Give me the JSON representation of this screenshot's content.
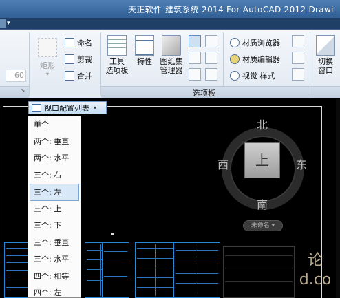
{
  "window": {
    "title": "天正软件-建筑系统 2014  For AutoCAD 2012   Drawi"
  },
  "ribbon": {
    "left_field_value": "60",
    "rect_label": "矩形",
    "rect_caret": "▾",
    "small_buttons": [
      "命名",
      "剪裁",
      "合并"
    ],
    "big_buttons": [
      {
        "label": "工具\n选项板",
        "icon": "tool-palette-icon"
      },
      {
        "label": "特性",
        "icon": "properties-icon"
      },
      {
        "label": "图纸集\n管理器",
        "icon": "sheet-set-icon"
      }
    ],
    "material_buttons": [
      "材质浏览器",
      "材质编辑器",
      "视觉 样式"
    ],
    "switch_window_label": "切换\n窗口",
    "panel_title": "选项板",
    "collapse_glyph": "↘"
  },
  "viewport_dropdown": {
    "label": "视口配置列表",
    "caret": "▾",
    "items": [
      "单个",
      "两个: 垂直",
      "两个: 水平",
      "三个: 右",
      "三个: 左",
      "三个: 上",
      "三个: 下",
      "三个: 垂直",
      "三个: 水平",
      "四个: 相等",
      "四个: 左"
    ],
    "selected_index": 4
  },
  "viewcube": {
    "north": "北",
    "south": "南",
    "east": "东",
    "west": "西",
    "face": "上",
    "wcs_label": "未命名",
    "wcs_caret": "▾"
  },
  "watermark": {
    "line1": "论",
    "line2": "d.co"
  },
  "colors": {
    "titlebar": "#2f5f95",
    "ribbon_bg": "#eaf0f7",
    "canvas_bg": "#000000",
    "drawing_lines": "#2b76bb",
    "menu_selected": "#d9e8f8"
  }
}
